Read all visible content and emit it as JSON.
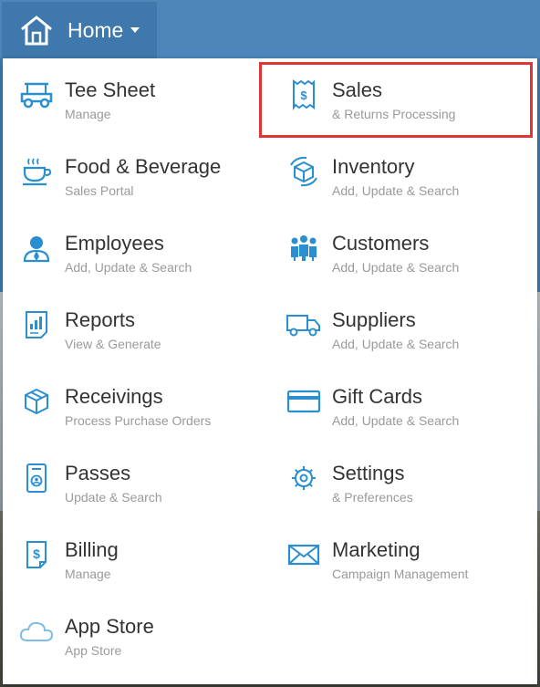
{
  "nav": {
    "home_label": "Home"
  },
  "colors": {
    "accent": "#2a8fd1",
    "topbar": "#4d87ba",
    "highlight": "#e23434"
  },
  "menu": {
    "items": [
      {
        "title": "Tee Sheet",
        "subtitle": "Manage",
        "icon": "golf-cart-icon"
      },
      {
        "title": "Sales",
        "subtitle": "& Returns Processing",
        "icon": "receipt-icon",
        "highlighted": true
      },
      {
        "title": "Food & Beverage",
        "subtitle": "Sales Portal",
        "icon": "coffee-cup-icon"
      },
      {
        "title": "Inventory",
        "subtitle": "Add, Update & Search",
        "icon": "box-cycle-icon"
      },
      {
        "title": "Employees",
        "subtitle": "Add, Update & Search",
        "icon": "employee-icon"
      },
      {
        "title": "Customers",
        "subtitle": "Add, Update & Search",
        "icon": "people-group-icon"
      },
      {
        "title": "Reports",
        "subtitle": "View & Generate",
        "icon": "report-chart-icon"
      },
      {
        "title": "Suppliers",
        "subtitle": "Add, Update & Search",
        "icon": "truck-icon"
      },
      {
        "title": "Receivings",
        "subtitle": "Process Purchase Orders",
        "icon": "package-icon"
      },
      {
        "title": "Gift Cards",
        "subtitle": "Add, Update & Search",
        "icon": "card-icon"
      },
      {
        "title": "Passes",
        "subtitle": "Update & Search",
        "icon": "pass-icon"
      },
      {
        "title": "Settings",
        "subtitle": "& Preferences",
        "icon": "gear-icon"
      },
      {
        "title": "Billing",
        "subtitle": "Manage",
        "icon": "bill-icon"
      },
      {
        "title": "Marketing",
        "subtitle": "Campaign Management",
        "icon": "envelope-icon"
      },
      {
        "title": "App Store",
        "subtitle": "App Store",
        "icon": "cloud-icon"
      }
    ]
  }
}
